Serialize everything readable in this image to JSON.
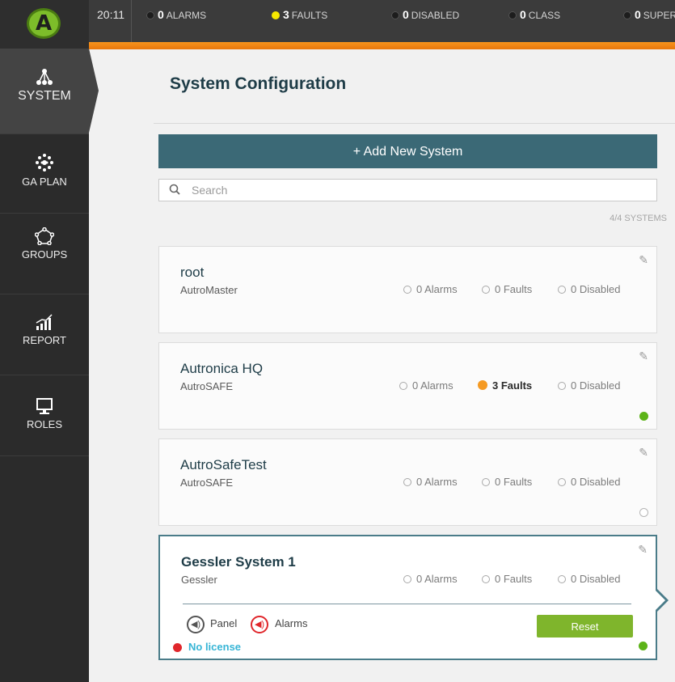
{
  "app": {
    "time": "20:11",
    "stats": [
      {
        "count": "0",
        "label": "ALARMS",
        "color": "#1d1d1d"
      },
      {
        "count": "3",
        "label": "FAULTS",
        "color": "#f6e800"
      },
      {
        "count": "0",
        "label": "DISABLED",
        "color": "#1d1d1d"
      },
      {
        "count": "0",
        "label": "CLASS",
        "color": "#1d1d1d"
      },
      {
        "count": "0",
        "label": "SUPER",
        "color": "#1d1d1d"
      }
    ]
  },
  "sidebar": {
    "items": [
      {
        "label": "SYSTEM",
        "icon": "system-icon",
        "active": true
      },
      {
        "label": "GA PLAN",
        "icon": "ga-plan-icon"
      },
      {
        "label": "GROUPS",
        "icon": "groups-icon"
      },
      {
        "label": "REPORT",
        "icon": "report-icon"
      },
      {
        "label": "ROLES",
        "icon": "roles-icon"
      }
    ]
  },
  "page": {
    "title": "System Configuration",
    "add_label": "+ Add New System",
    "search_placeholder": "Search",
    "count": "4/4 SYSTEMS"
  },
  "systems": [
    {
      "name": "root",
      "type": "AutroMaster",
      "alarms": "0 Alarms",
      "faults": "0 Faults",
      "disabled": "0 Disabled"
    },
    {
      "name": "Autronica HQ",
      "type": "AutroSAFE",
      "alarms": "0 Alarms",
      "faults": "3 Faults",
      "disabled": "0 Disabled"
    },
    {
      "name": "AutroSafeTest",
      "type": "AutroSAFE",
      "alarms": "0 Alarms",
      "faults": "0 Faults",
      "disabled": "0 Disabled"
    },
    {
      "name": "Gessler System 1",
      "type": "Gessler",
      "alarms": "0 Alarms",
      "faults": "0 Faults",
      "disabled": "0 Disabled",
      "panel_label": "Panel",
      "alarms_sound_label": "Alarms",
      "reset_label": "Reset",
      "license": "No license"
    }
  ],
  "colors": {
    "accent": "#3b6976",
    "orange": "#f7941d",
    "ok": "#5cb318",
    "fault": "#f59a22",
    "license": "#37b5d6"
  }
}
